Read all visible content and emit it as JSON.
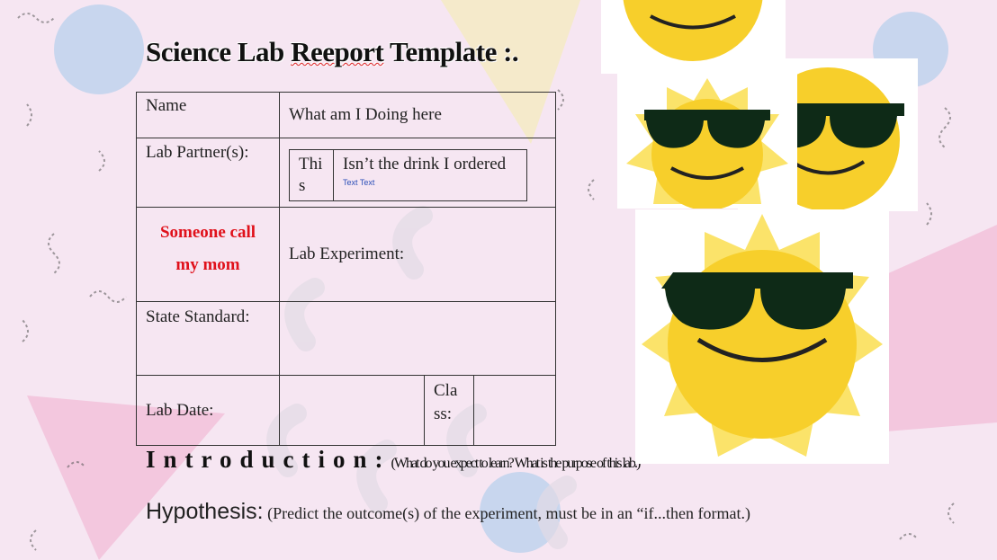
{
  "title": {
    "part1": "Science Lab ",
    "typo": "Reeport",
    "part2": " Template :."
  },
  "table": {
    "name_label": "Name",
    "name_value": "What am I Doing here",
    "partners_label": "Lab Partner(s):",
    "partner_cell1": "Thi s",
    "partner_cell2": "Isn’t the drink I ordered",
    "textbox_label": "Text Text",
    "red_note_line1": "Someone call",
    "red_note_line2": "my mom",
    "experiment_label": "Lab Experiment:",
    "standard_label": "State Standard:",
    "date_label": "Lab Date:",
    "class_label": "Cla ss:"
  },
  "intro": {
    "heading": "Introduction:",
    "prompt": "(What do you expect to learn? What is the purpose of this lab.)"
  },
  "hypothesis": {
    "heading": "Hypothesis:",
    "prompt": "(Predict the outcome(s) of the experiment, must be in an “if...then format.)"
  },
  "colors": {
    "background": "#f6e6f2",
    "accent_red": "#e0111b",
    "sun_yellow": "#f7cf2b"
  }
}
